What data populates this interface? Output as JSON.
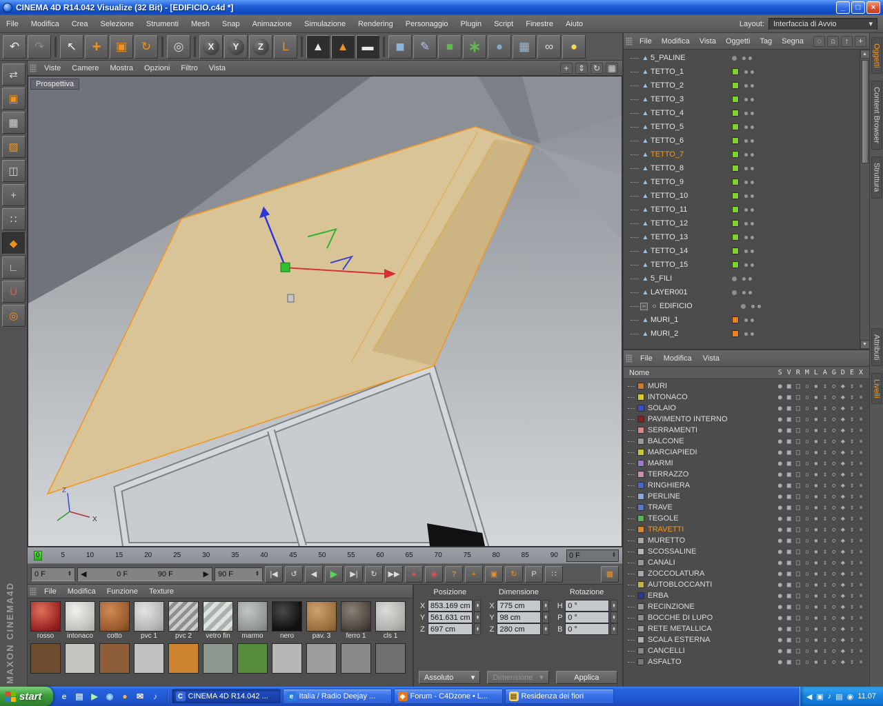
{
  "glyphs": {
    "caret": "▾",
    "up": "▲",
    "down": "▼",
    "left": "◀",
    "right": "▶",
    "minimize": "_",
    "restore": "□",
    "close": "×",
    "expander_open": "−"
  },
  "window": {
    "title": "CINEMA 4D R14.042 Visualize (32 Bit) - [EDIFICIO.c4d *]"
  },
  "menubar": {
    "items": [
      "File",
      "Modifica",
      "Crea",
      "Selezione",
      "Strumenti",
      "Mesh",
      "Snap",
      "Animazione",
      "Simulazione",
      "Rendering",
      "Personaggio",
      "Plugin",
      "Script",
      "Finestre",
      "Aiuto"
    ],
    "layout_label": "Layout:",
    "layout_value": "Interfaccia di Avvio"
  },
  "toolbar": {
    "icons": [
      {
        "name": "undo-icon",
        "g": "↶",
        "c": "#e6e6e6"
      },
      {
        "name": "redo-icon",
        "g": "↷",
        "c": "#8c8c8c"
      },
      {
        "name": "separator",
        "sep": true
      },
      {
        "name": "live-selection-icon",
        "g": "↖",
        "c": "#f0f0f0"
      },
      {
        "name": "move-icon",
        "g": "+",
        "c": "#f0921e",
        "big": true
      },
      {
        "name": "scale-icon",
        "g": "▣",
        "c": "#f0921e"
      },
      {
        "name": "rotate-icon",
        "g": "↻",
        "c": "#f0921e"
      },
      {
        "name": "separator",
        "sep": true
      },
      {
        "name": "last-tool-icon",
        "g": "◎",
        "c": "#d8d8d8"
      },
      {
        "name": "separator",
        "sep": true
      },
      {
        "name": "x-axis-lock-icon",
        "g": "X",
        "circ": true
      },
      {
        "name": "y-axis-lock-icon",
        "g": "Y",
        "circ": true
      },
      {
        "name": "z-axis-lock-icon",
        "g": "Z",
        "circ": true
      },
      {
        "name": "coordinate-system-icon",
        "g": "L",
        "c": "#f0921e"
      },
      {
        "name": "separator",
        "sep": true
      },
      {
        "name": "render-view-icon",
        "g": "▲",
        "c": "#e8e8e8",
        "dark": true
      },
      {
        "name": "render-picture-viewer-icon",
        "g": "▲",
        "c": "#f0921e",
        "dark": true
      },
      {
        "name": "render-settings-icon",
        "g": "▬",
        "c": "#e8e8e8",
        "dark": true
      },
      {
        "name": "separator",
        "sep": true
      },
      {
        "name": "add-cube-icon",
        "g": "■",
        "c": "#8fb4dc",
        "big": true
      },
      {
        "name": "spline-pen-icon",
        "g": "✎",
        "c": "#a8c4e8"
      },
      {
        "name": "subdivision-surface-icon",
        "g": "■",
        "c": "#62b64e"
      },
      {
        "name": "array-icon",
        "g": "∗",
        "c": "#62b64e",
        "big": true
      },
      {
        "name": "metaball-icon",
        "g": "●",
        "c": "#7fa8d4"
      },
      {
        "name": "floor-icon",
        "g": "▦",
        "c": "#9fb8d0"
      },
      {
        "name": "camera-icon",
        "g": "∞",
        "c": "#d8d8d8"
      },
      {
        "name": "light-icon",
        "g": "●",
        "c": "#f2d44e"
      }
    ]
  },
  "left_toolbar": {
    "brand": "MAXON  CINEMA4D",
    "icons": [
      {
        "name": "convert-icon",
        "g": "⇄",
        "c": "#d0d0d0"
      },
      {
        "name": "make-editable-icon",
        "g": "▣",
        "c": "#f0921e"
      },
      {
        "name": "model-mode-icon",
        "g": "▦",
        "c": "#d0d0d0"
      },
      {
        "name": "texture-mode-icon",
        "g": "▨",
        "c": "#f0921e"
      },
      {
        "name": "workplane-icon",
        "g": "◫",
        "c": "#d0d0d0"
      },
      {
        "name": "object-axis-icon",
        "g": "+",
        "c": "#d0d0d0"
      },
      {
        "name": "points-mode-icon",
        "g": "∷",
        "c": "#d0d0d0"
      },
      {
        "name": "polygons-mode-icon",
        "g": "◆",
        "c": "#f0921e",
        "active": true
      },
      {
        "name": "edges-mode-icon",
        "g": "∟",
        "c": "#d0d0d0"
      },
      {
        "name": "magnet-icon",
        "g": "U",
        "c": "#d06050"
      },
      {
        "name": "snap-icon",
        "g": "◎",
        "c": "#f0921e"
      }
    ]
  },
  "viewport": {
    "menus": [
      "Viste",
      "Camere",
      "Mostra",
      "Opzioni",
      "Filtro",
      "Vista"
    ],
    "view_label": "Prospettiva",
    "nav_icons": [
      {
        "name": "pan-view-icon",
        "g": "+"
      },
      {
        "name": "zoom-view-icon",
        "g": "⇕"
      },
      {
        "name": "rotate-view-icon",
        "g": "↻"
      },
      {
        "name": "toggle-views-icon",
        "g": "▦"
      }
    ]
  },
  "timeline": {
    "ticks": [
      "0",
      "5",
      "10",
      "15",
      "20",
      "25",
      "30",
      "35",
      "40",
      "45",
      "50",
      "55",
      "60",
      "65",
      "70",
      "75",
      "80",
      "85",
      "90"
    ],
    "current": "0 F"
  },
  "transport": {
    "start": "0 F",
    "range_start": "0 F",
    "range_end": "90 F",
    "end": "90 F",
    "buttons": [
      {
        "name": "goto-start-button",
        "g": "|◀",
        "c": "#dcdcdc"
      },
      {
        "name": "play-reverse-button",
        "g": "↺",
        "c": "#dcdcdc"
      },
      {
        "name": "step-back-button",
        "g": "◀",
        "c": "#dcdcdc"
      },
      {
        "name": "play-button",
        "g": "▶",
        "c": "#56d656",
        "play": true
      },
      {
        "name": "step-forward-button",
        "g": "▶|",
        "c": "#dcdcdc"
      },
      {
        "name": "loop-button",
        "g": "↻",
        "c": "#dcdcdc"
      },
      {
        "name": "goto-end-button",
        "g": "▶▶",
        "c": "#dcdcdc"
      },
      {
        "name": "record-keyframe-button",
        "g": "●",
        "c": "#e05050"
      },
      {
        "name": "autokey-button",
        "g": "◉",
        "c": "#e05050"
      },
      {
        "name": "sound-button",
        "g": "?",
        "c": "#f0a030"
      },
      {
        "name": "key-position-icon",
        "g": "+",
        "c": "#f0921e"
      },
      {
        "name": "key-scale-icon",
        "g": "▣",
        "c": "#f0921e"
      },
      {
        "name": "key-rotation-icon",
        "g": "↻",
        "c": "#f0921e"
      },
      {
        "name": "key-parameter-icon",
        "g": "P",
        "c": "#d8d8d8"
      },
      {
        "name": "key-pla-icon",
        "g": "∷",
        "c": "#d8d8d8"
      },
      {
        "name": "keyframe-presets-icon",
        "g": "▦",
        "c": "#f0921e",
        "right": true
      }
    ]
  },
  "materials": {
    "menus": [
      "File",
      "Modifica",
      "Funzione",
      "Texture"
    ],
    "items": [
      {
        "name": "rosso",
        "bg": "radial-gradient(circle at 35% 30%, #e0705c, #9a2424 70%, #701616)"
      },
      {
        "name": "intonaco",
        "bg": "radial-gradient(circle at 35% 30%, #f0f0ec, #c2c2bc 70%, #a8a8a2)"
      },
      {
        "name": "cotto",
        "bg": "radial-gradient(circle at 35% 30%, #d08a54, #9a5a2e 70%, #70421e)"
      },
      {
        "name": "pvc 1",
        "bg": "radial-gradient(circle at 35% 30%, #e4e4e4, #b4b4b4 70%, #989898)"
      },
      {
        "name": "pvc 2",
        "bg": "repeating-linear-gradient(135deg, #cccccc 0 5px, #8e8e8e 5px 10px)"
      },
      {
        "name": "vetro fin",
        "bg": "repeating-linear-gradient(135deg, #dde2de 0 6px, #aab2ac 6px 12px)"
      },
      {
        "name": "marmo",
        "bg": "radial-gradient(circle at 35% 30%, #c2c6c2, #929692 70%, #7a7e7a)"
      },
      {
        "name": "nero",
        "bg": "radial-gradient(circle at 35% 30%, #4a4a4a, #111111 70%)"
      },
      {
        "name": "pav. 3",
        "bg": "radial-gradient(circle at 35% 30%, #cfa06a, #9a7040 70%, #7a5830)"
      },
      {
        "name": "ferro 1",
        "bg": "radial-gradient(circle at 35% 30%, #8a8078, #4e463e 70%, #322c26)"
      },
      {
        "name": "cls 1",
        "bg": "radial-gradient(circle at 35% 30%, #dcdcd8, #b0b0ac 70%, #949490)"
      }
    ],
    "more_items": [
      {
        "name": "",
        "bg": "#6e4c30"
      },
      {
        "name": "",
        "bg": "#c6c4be"
      },
      {
        "name": "",
        "bg": "#8e5e3a"
      },
      {
        "name": "",
        "bg": "#c0c0c0"
      },
      {
        "name": "",
        "bg": "#cc8430"
      },
      {
        "name": "",
        "bg": "#8e988e"
      },
      {
        "name": "",
        "bg": "#548c3c"
      },
      {
        "name": "",
        "bg": "#b6b6b6"
      },
      {
        "name": "",
        "bg": "#9e9e9e"
      },
      {
        "name": "",
        "bg": "#8a8a8a"
      },
      {
        "name": "",
        "bg": "#707070"
      }
    ]
  },
  "coordinates": {
    "pos_title": "Posizione",
    "dim_title": "Dimensione",
    "rot_title": "Rotazione",
    "pos_rows": [
      {
        "k": "X",
        "v": "853.169 cm"
      },
      {
        "k": "Y",
        "v": "561.631 cm"
      },
      {
        "k": "Z",
        "v": "697 cm"
      }
    ],
    "dim_rows": [
      {
        "k": "X",
        "v": "775 cm"
      },
      {
        "k": "Y",
        "v": "98 cm"
      },
      {
        "k": "Z",
        "v": "280 cm"
      }
    ],
    "rot_rows": [
      {
        "k": "H",
        "v": "0 °"
      },
      {
        "k": "P",
        "v": "0 °"
      },
      {
        "k": "B",
        "v": "0 °"
      }
    ],
    "mode": "Assoluto",
    "dim_mode": "Dimensione",
    "apply_label": "Applica"
  },
  "object_manager": {
    "menus": [
      "File",
      "Modifica",
      "Vista",
      "Oggetti",
      "Tag",
      "Segna"
    ],
    "icons": [
      {
        "name": "search-icon",
        "g": "◌"
      },
      {
        "name": "home-icon",
        "g": "⌂"
      },
      {
        "name": "up-icon",
        "g": "↑"
      },
      {
        "name": "add-icon",
        "g": "+"
      }
    ],
    "objects": [
      {
        "name": "5_PALINE",
        "icon": "▲",
        "iconc": "#9cc2e6"
      },
      {
        "name": "TETTO_1",
        "icon": "▲",
        "iconc": "#9cc2e6",
        "chip": "#7fd32b"
      },
      {
        "name": "TETTO_2",
        "icon": "▲",
        "iconc": "#9cc2e6",
        "chip": "#7fd32b"
      },
      {
        "name": "TETTO_3",
        "icon": "▲",
        "iconc": "#9cc2e6",
        "chip": "#7fd32b"
      },
      {
        "name": "TETTO_4",
        "icon": "▲",
        "iconc": "#9cc2e6",
        "chip": "#7fd32b"
      },
      {
        "name": "TETTO_5",
        "icon": "▲",
        "iconc": "#9cc2e6",
        "chip": "#7fd32b"
      },
      {
        "name": "TETTO_6",
        "icon": "▲",
        "iconc": "#9cc2e6",
        "chip": "#7fd32b"
      },
      {
        "name": "TETTO_7",
        "icon": "▲",
        "iconc": "#9cc2e6",
        "chip": "#7fd32b",
        "sel": true
      },
      {
        "name": "TETTO_8",
        "icon": "▲",
        "iconc": "#9cc2e6",
        "chip": "#7fd32b"
      },
      {
        "name": "TETTO_9",
        "icon": "▲",
        "iconc": "#9cc2e6",
        "chip": "#7fd32b"
      },
      {
        "name": "TETTO_10",
        "icon": "▲",
        "iconc": "#9cc2e6",
        "chip": "#7fd32b"
      },
      {
        "name": "TETTO_11",
        "icon": "▲",
        "iconc": "#9cc2e6",
        "chip": "#7fd32b"
      },
      {
        "name": "TETTO_12",
        "icon": "▲",
        "iconc": "#9cc2e6",
        "chip": "#7fd32b"
      },
      {
        "name": "TETTO_13",
        "icon": "▲",
        "iconc": "#9cc2e6",
        "chip": "#7fd32b"
      },
      {
        "name": "TETTO_14",
        "icon": "▲",
        "iconc": "#9cc2e6",
        "chip": "#7fd32b"
      },
      {
        "name": "TETTO_15",
        "icon": "▲",
        "iconc": "#9cc2e6",
        "chip": "#7fd32b"
      },
      {
        "name": "5_FILI",
        "icon": "▲",
        "iconc": "#9cc2e6"
      },
      {
        "name": "LAYER001",
        "icon": "▲",
        "iconc": "#9cc2e6"
      },
      {
        "name": "EDIFICIO",
        "icon": "○",
        "iconc": "#e8e8e8",
        "exp": "−"
      },
      {
        "name": "MURI_1",
        "icon": "▲",
        "iconc": "#9cc2e6",
        "chip": "#e8821e"
      },
      {
        "name": "MURI_2",
        "icon": "▲",
        "iconc": "#9cc2e6",
        "chip": "#e8821e"
      }
    ]
  },
  "layer_manager": {
    "menus": [
      "File",
      "Modifica",
      "Vista"
    ],
    "name_header": "Nome",
    "columns": [
      "S",
      "V",
      "R",
      "M",
      "L",
      "A",
      "G",
      "D",
      "E",
      "X"
    ],
    "columns_display": "SVRMLAGDEX",
    "row_icon_names": [
      "solo-dot-icon",
      "view-icon",
      "render-icon",
      "manager-icon",
      "lock-icon",
      "animation-icon",
      "generators-icon",
      "deformers-icon",
      "expressions-icon",
      "xref-icon"
    ],
    "row_icons_display": "●■□▫▪↕◇◆↕×",
    "layers": [
      {
        "name": "MURI",
        "color": "#c87a32"
      },
      {
        "name": "INTONACO",
        "color": "#d8c832"
      },
      {
        "name": "SOLAIO",
        "color": "#3850c8"
      },
      {
        "name": "PAVIMENTO INTERNO",
        "color": "#8a2020"
      },
      {
        "name": "SERRAMENTI",
        "color": "#d88a8a"
      },
      {
        "name": "BALCONE",
        "color": "#9a9a9a"
      },
      {
        "name": "MARCIAPIEDI",
        "color": "#c8c83c"
      },
      {
        "name": "MARMI",
        "color": "#9a7ac8"
      },
      {
        "name": "TERRAZZO",
        "color": "#c890b0"
      },
      {
        "name": "RINGHIERA",
        "color": "#4868c8"
      },
      {
        "name": "PERLINE",
        "color": "#88a8d8"
      },
      {
        "name": "TRAVE",
        "color": "#5878c8"
      },
      {
        "name": "TEGOLE",
        "color": "#58b058"
      },
      {
        "name": "TRAVETTI",
        "color": "#d8882a",
        "sel": true
      },
      {
        "name": "MURETTO",
        "color": "#a8a8a8"
      },
      {
        "name": "SCOSSALINE",
        "color": "#b8b8b8"
      },
      {
        "name": "CANALI",
        "color": "#989898"
      },
      {
        "name": "ZOCCOLATURA",
        "color": "#a8a8a8"
      },
      {
        "name": "AUTOBLOCCANTI",
        "color": "#c8b048"
      },
      {
        "name": "ERBA",
        "color": "#283c88"
      },
      {
        "name": "RECINZIONE",
        "color": "#989898"
      },
      {
        "name": "BOCCHE DI LUPO",
        "color": "#909090"
      },
      {
        "name": "RETE METALLICA",
        "color": "#a0a0a0"
      },
      {
        "name": "SCALA ESTERNA",
        "color": "#b0b0b0"
      },
      {
        "name": "CANCELLI",
        "color": "#888888"
      },
      {
        "name": "ASFALTO",
        "color": "#787878"
      }
    ]
  },
  "side_tabs": {
    "top": [
      {
        "label": "Oggetti",
        "active": true
      },
      {
        "label": "Content Browser"
      },
      {
        "label": "Struttura"
      }
    ],
    "bottom": [
      {
        "label": "Attributi"
      },
      {
        "label": "Livelli",
        "active": true
      }
    ]
  },
  "taskbar": {
    "start_label": "start",
    "quicklaunch": [
      {
        "name": "internet-explorer-icon",
        "g": "e",
        "c": "#cfe0ff"
      },
      {
        "name": "show-desktop-icon",
        "g": "▤",
        "c": "#cfe0ff"
      },
      {
        "name": "media-player-icon",
        "g": "▶",
        "c": "#aef0ae"
      },
      {
        "name": "messenger-icon",
        "g": "◉",
        "c": "#9fd4ff"
      },
      {
        "name": "firefox-icon",
        "g": "●",
        "c": "#ffb347"
      },
      {
        "name": "mail-icon",
        "g": "✉",
        "c": "#ffffff"
      },
      {
        "name": "music-icon",
        "g": "♪",
        "c": "#e8d8ff"
      }
    ],
    "tasks": [
      {
        "title": "CINEMA 4D R14.042 ...",
        "active": true,
        "ig": "C",
        "ic": "#ffffff",
        "ibg": "#3a6ad8"
      },
      {
        "title": "Italia / Radio Deejay ...",
        "ig": "e",
        "ic": "#ffffff",
        "ibg": "#2a7ae0"
      },
      {
        "title": "Forum - C4Dzone • L...",
        "ig": "◆",
        "ic": "#fff8e0",
        "ibg": "#e07820"
      },
      {
        "title": "Residenza dei fiori",
        "ig": "▤",
        "ic": "#7a5a10",
        "ibg": "#f4d478"
      }
    ],
    "tray_icons": [
      {
        "name": "hide-tray-icon",
        "g": "◀"
      },
      {
        "name": "display-icon",
        "g": "▣"
      },
      {
        "name": "volume-icon",
        "g": "♪"
      },
      {
        "name": "network-icon",
        "g": "▤"
      },
      {
        "name": "shield-icon",
        "g": "◉"
      }
    ],
    "time": "11.07"
  }
}
